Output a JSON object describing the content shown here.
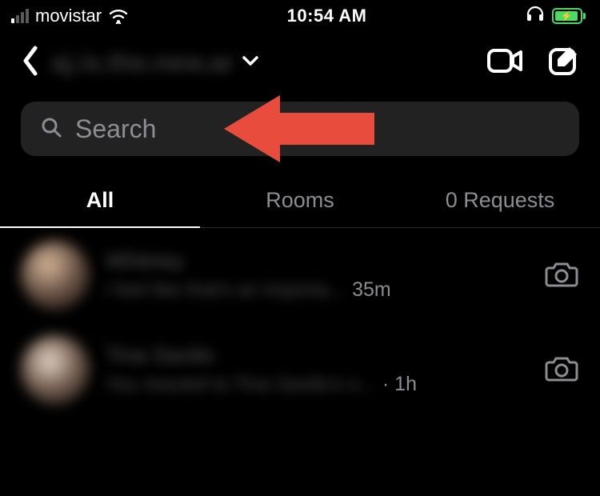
{
  "status": {
    "carrier": "movistar",
    "time": "10:54 AM"
  },
  "header": {
    "username_blur": "aj.is.the.new.ar"
  },
  "search": {
    "placeholder": "Search"
  },
  "tabs": {
    "all": "All",
    "rooms": "Rooms",
    "requests": "0 Requests"
  },
  "conversations": [
    {
      "name_blur": "Whitney",
      "snippet_blur": "I feel like that's an importa...",
      "time": "35m"
    },
    {
      "name_blur": "Tina Sardis",
      "snippet_blur": "You reacted to Tina Sardis's s...",
      "time": "· 1h"
    }
  ]
}
